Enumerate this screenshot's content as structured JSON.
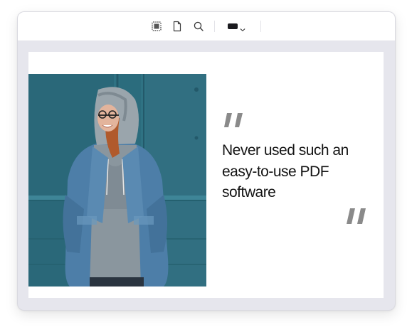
{
  "toolbar": {
    "icons": [
      "select-region-icon",
      "page-icon",
      "search-icon"
    ],
    "color_picker": {
      "selected_color": "#1b1b1f"
    }
  },
  "document": {
    "quote": "Never used such an easy-to-use PDF software",
    "photo": {
      "subject": "smiling woman in grey hoodie and denim jacket"
    }
  },
  "colors": {
    "quote_mark": "#8a8a8a",
    "frame_background": "#e6e6ed",
    "photo_wall": "#2d6f80"
  }
}
